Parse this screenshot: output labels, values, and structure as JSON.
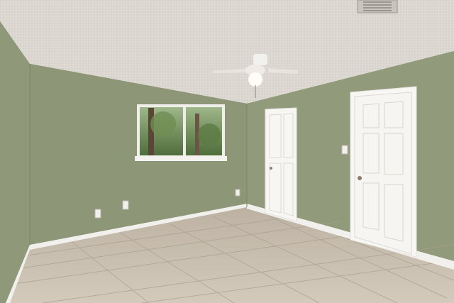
{
  "scene": {
    "description_colors": {
      "ceiling": "#ddd9d2",
      "wall_left": "#8f9878",
      "wall_back": "#8d9676",
      "wall_right": "#919a7b",
      "floor": "#c9bfb0",
      "trim": "#f4f2ee",
      "door": "#f6f5f2"
    },
    "elements": {
      "ceiling_fan": "ceiling-fan-icon",
      "window": "window",
      "doors": [
        "closet-door",
        "entry-door"
      ]
    }
  }
}
